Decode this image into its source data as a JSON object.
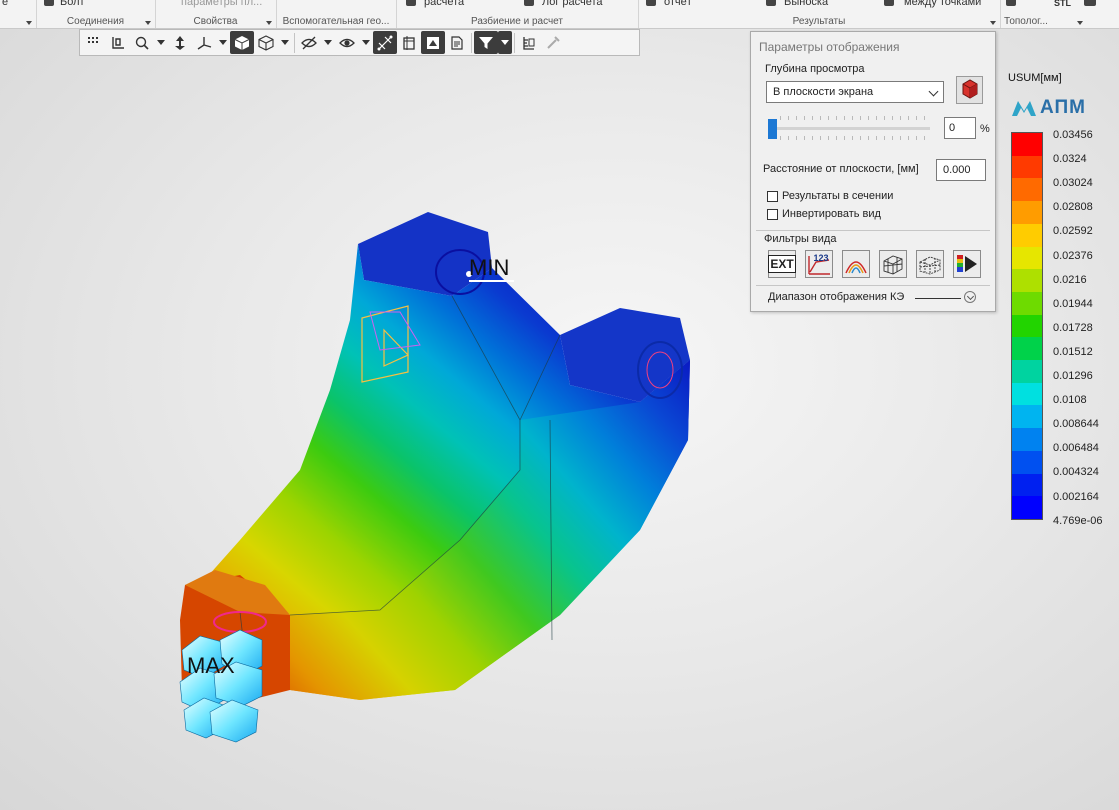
{
  "ribbon": {
    "groups": [
      {
        "top": "е",
        "caption": ""
      },
      {
        "top": "Болт",
        "caption": "Соединения"
      },
      {
        "top": "параметры пл...",
        "caption": "Свойства"
      },
      {
        "top": "",
        "caption": "Вспомогательная гео..."
      },
      {
        "top": "расчета",
        "top2": "Лог расчета",
        "caption": "Разбиение и расчет"
      },
      {
        "top": "отчёт",
        "top2": "Выноска",
        "top3": "между точками",
        "caption": "Результаты"
      },
      {
        "top": "STL",
        "caption": "Тополог..."
      }
    ]
  },
  "view_toolbar": {
    "buttons": [
      "grid-icon",
      "select-frame-icon",
      "zoom-icon",
      "pan-icon",
      "axes-icon",
      "shaded-view-icon",
      "wireframe-view-icon",
      "hide-icon",
      "visibility-icon",
      "mesh-icon",
      "section-icon",
      "render-icon",
      "report-icon",
      "filter-icon",
      "measure-icon",
      "eyedropper-icon"
    ]
  },
  "model": {
    "min_label": "MIN",
    "max_label": "MAX"
  },
  "panel": {
    "title": "Параметры отображения",
    "depth_label": "Глубина просмотра",
    "depth_select": "В плоскости экрана",
    "depth_percent": "0",
    "percent_sign": "%",
    "depth_slider_fraction": 0,
    "distance_label": "Расстояние от плоскости, [мм]",
    "distance_value": "0.000",
    "check_section": "Результаты в сечении",
    "check_section_checked": false,
    "check_invert": "Инвертировать вид",
    "check_invert_checked": false,
    "filters_label": "Фильтры вида",
    "filter_buttons": [
      "ext-filter-icon",
      "values-123-icon",
      "isolines-icon",
      "mesh-3d-icon",
      "deformed-mesh-icon",
      "play-palette-icon"
    ],
    "ext_text": "EXT",
    "num_text": "123",
    "range_label": "Диапазон отображения КЭ"
  },
  "legend": {
    "title": "USUM[мм]",
    "logo_text": "АПМ",
    "colors": [
      "#ff0000",
      "#ff3a00",
      "#ff6a00",
      "#ff9c00",
      "#ffcc00",
      "#e6e600",
      "#aee000",
      "#6edb00",
      "#22d400",
      "#00d24a",
      "#00d3a0",
      "#00e0e0",
      "#00b4f0",
      "#0082f0",
      "#0050f0",
      "#0020f0",
      "#0000ff"
    ],
    "values": [
      "0.03456",
      "0.0324",
      "0.03024",
      "0.02808",
      "0.02592",
      "0.02376",
      "0.0216",
      "0.01944",
      "0.01728",
      "0.01512",
      "0.01296",
      "0.0108",
      "0.008644",
      "0.006484",
      "0.004324",
      "0.002164",
      "4.769e-06"
    ]
  }
}
